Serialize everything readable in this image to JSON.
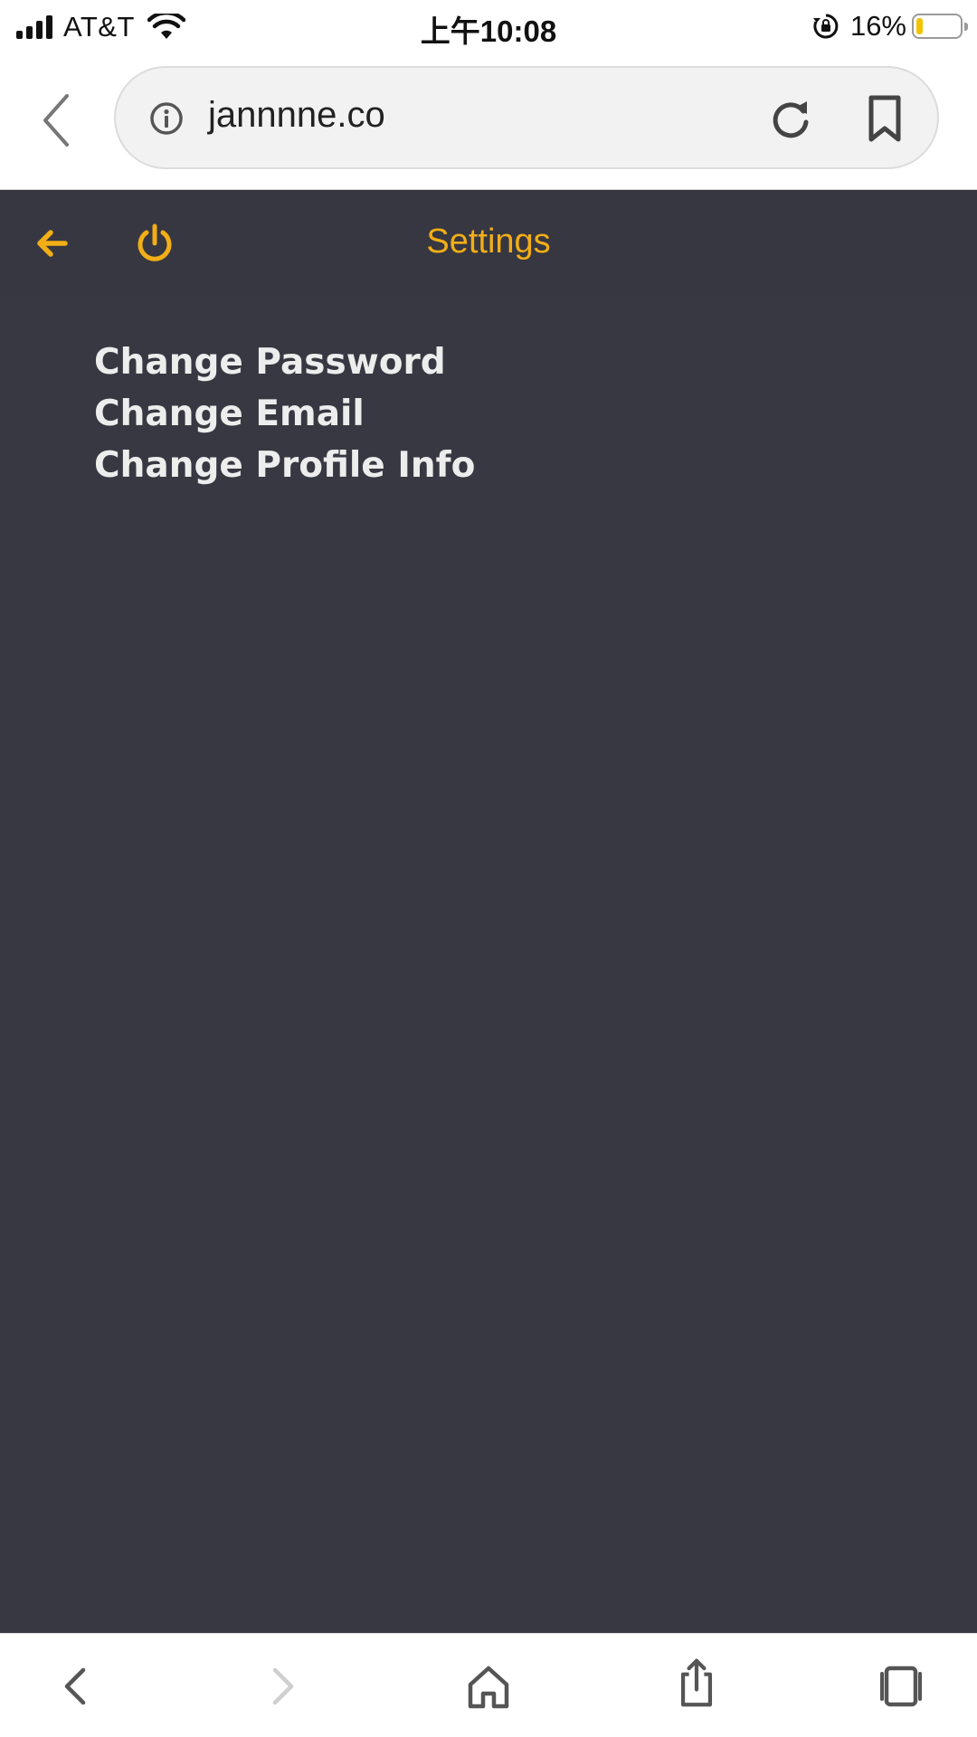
{
  "status_bar": {
    "carrier": "AT&T",
    "time": "上午10:08",
    "battery_percent": "16%",
    "battery_level": 0.16,
    "signal_bars": 4,
    "battery_color": "#f0c400"
  },
  "browser": {
    "url": "jannnne.co",
    "icons": [
      "back-icon",
      "info-icon",
      "reload-icon",
      "bookmark-icon"
    ]
  },
  "app": {
    "title": "Settings",
    "accent_color": "#f2ae16",
    "background_color": "#383842",
    "header_icons": [
      "arrow-left-icon",
      "power-icon"
    ],
    "menu": [
      {
        "label": "Change Password"
      },
      {
        "label": "Change Email"
      },
      {
        "label": "Change Profile Info"
      }
    ]
  },
  "toolbar": {
    "icons": [
      "back-icon",
      "forward-icon",
      "home-icon",
      "share-icon",
      "tabs-icon"
    ]
  }
}
